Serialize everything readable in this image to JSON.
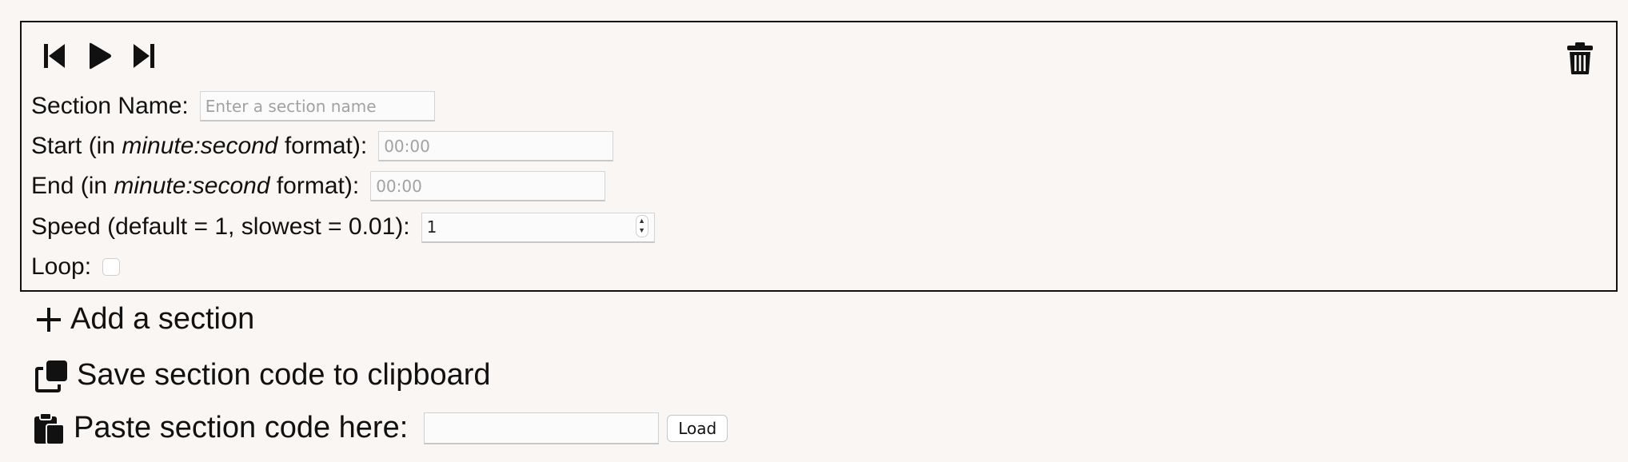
{
  "section": {
    "transport": {
      "previous_icon": "skip-previous-icon",
      "play_icon": "play-icon",
      "next_icon": "skip-next-icon"
    },
    "delete_icon": "trash-icon",
    "name_label": "Section Name:",
    "name_placeholder": "Enter a section name",
    "start_label_pre": "Start (in ",
    "start_label_em": "minute:second",
    "start_label_post": " format):",
    "start_placeholder": "00:00",
    "end_label_pre": "End (in ",
    "end_label_em": "minute:second",
    "end_label_post": " format):",
    "end_placeholder": "00:00",
    "speed_label": "Speed (default = 1, slowest = 0.01):",
    "speed_value": "1",
    "loop_label": "Loop:",
    "loop_checked": false
  },
  "actions": {
    "add_label": "Add a section",
    "add_icon": "plus-icon",
    "save_label": "Save section code to clipboard",
    "save_icon": "copy-icon",
    "paste_label": "Paste section code here:",
    "paste_icon": "paste-icon",
    "paste_value": "",
    "load_label": "Load"
  }
}
